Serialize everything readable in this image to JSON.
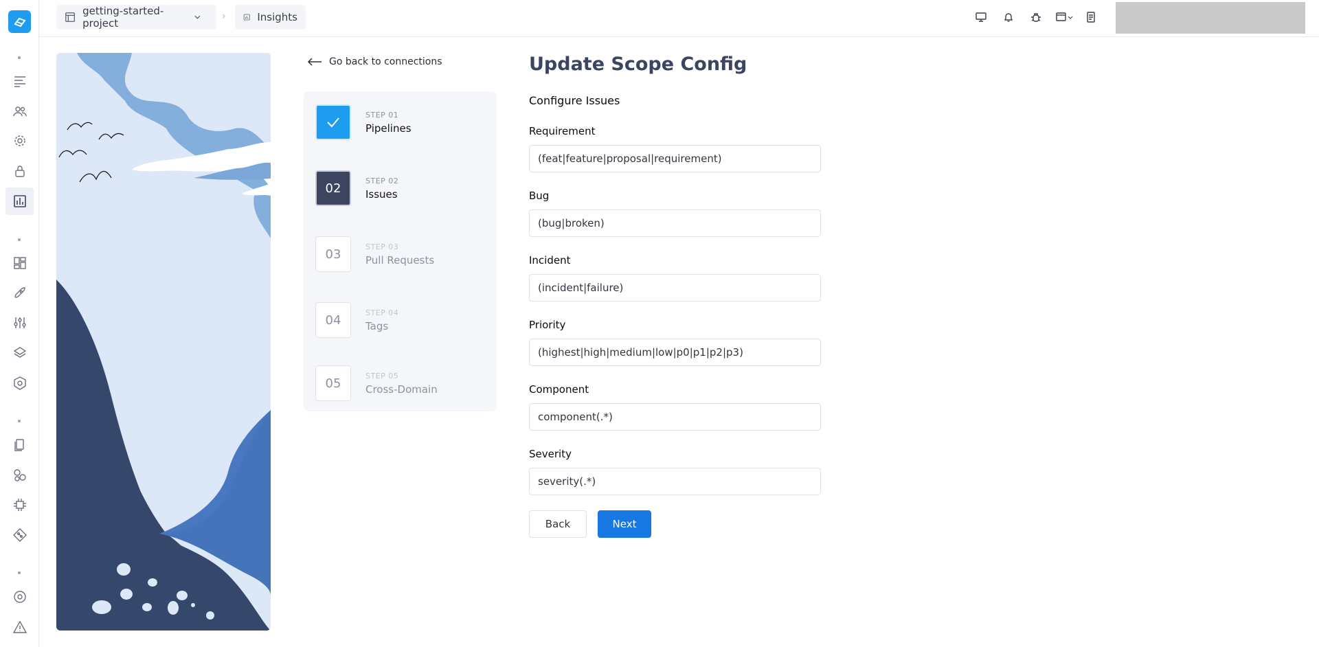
{
  "topbar": {
    "project_label": "getting-started-project",
    "page_label": "Insights",
    "icons": [
      "monitor-icon",
      "bell-icon",
      "bug-icon",
      "window-icon",
      "document-icon"
    ]
  },
  "rail": {
    "icons": [
      "list-icon",
      "users-icon",
      "gear-icon",
      "lock-icon",
      "chart-icon",
      "grid-icon",
      "rocket-icon",
      "sliders-icon",
      "layers-icon",
      "badge-icon",
      "files-icon",
      "shapes-icon",
      "plug-icon",
      "git-icon",
      "settings-circle-icon",
      "warning-icon"
    ]
  },
  "back_link": "Go back to connections",
  "steps": [
    {
      "label": "STEP 01",
      "name": "Pipelines",
      "badge": "",
      "state": "done"
    },
    {
      "label": "STEP 02",
      "name": "Issues",
      "badge": "02",
      "state": "current"
    },
    {
      "label": "STEP 03",
      "name": "Pull Requests",
      "badge": "03",
      "state": "todo"
    },
    {
      "label": "STEP 04",
      "name": "Tags",
      "badge": "04",
      "state": "todo"
    },
    {
      "label": "STEP 05",
      "name": "Cross-Domain",
      "badge": "05",
      "state": "todo"
    }
  ],
  "form": {
    "title": "Update Scope Config",
    "section": "Configure Issues",
    "fields": [
      {
        "label": "Requirement",
        "value": "(feat|feature|proposal|requirement)"
      },
      {
        "label": "Bug",
        "value": "(bug|broken)"
      },
      {
        "label": "Incident",
        "value": "(incident|failure)"
      },
      {
        "label": "Priority",
        "value": "(highest|high|medium|low|p0|p1|p2|p3)"
      },
      {
        "label": "Component",
        "value": "component(.*)"
      },
      {
        "label": "Severity",
        "value": "severity(.*)"
      }
    ],
    "back_label": "Back",
    "next_label": "Next"
  },
  "colors": {
    "accent": "#1e9cf0",
    "primary_button": "#1878e2",
    "current_step": "#3d4460",
    "title": "#3b4461"
  }
}
